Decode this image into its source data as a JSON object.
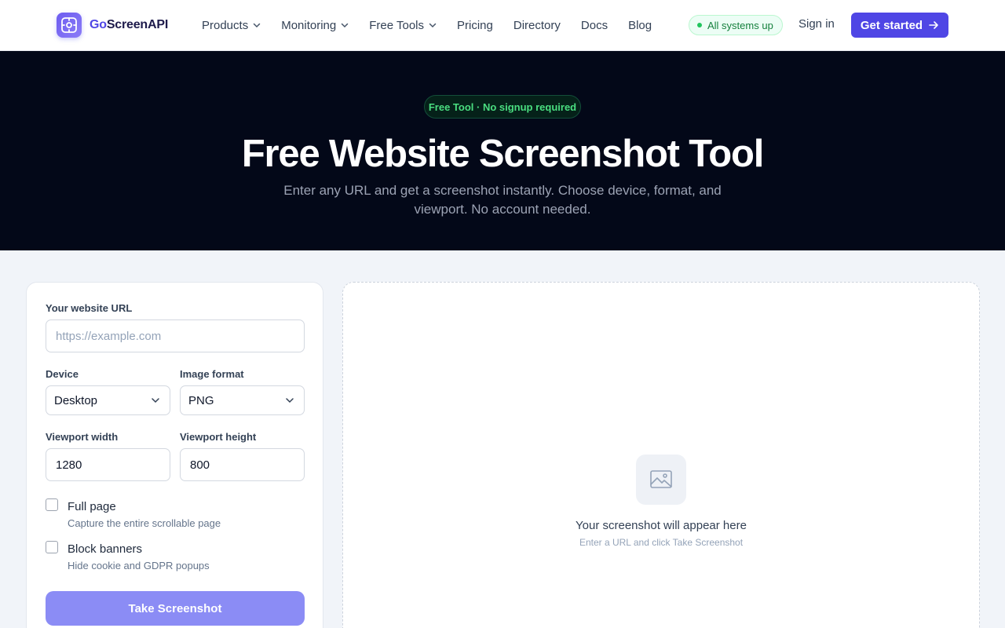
{
  "brand": {
    "prefix": "Go",
    "name": "ScreenAPI"
  },
  "nav": {
    "items": [
      {
        "label": "Products",
        "dropdown": true
      },
      {
        "label": "Monitoring",
        "dropdown": true
      },
      {
        "label": "Free Tools",
        "dropdown": true
      },
      {
        "label": "Pricing",
        "dropdown": false
      },
      {
        "label": "Directory",
        "dropdown": false
      },
      {
        "label": "Docs",
        "dropdown": false
      },
      {
        "label": "Blog",
        "dropdown": false
      }
    ],
    "status": "All systems up",
    "signin": "Sign in",
    "cta": "Get started"
  },
  "hero": {
    "pill": "Free Tool · No signup required",
    "title": "Free Website Screenshot Tool",
    "subtitle": "Enter any URL and get a screenshot instantly. Choose device, format, and viewport. No account needed."
  },
  "form": {
    "url_label": "Your website URL",
    "url_placeholder": "https://example.com",
    "device_label": "Device",
    "device_value": "Desktop",
    "format_label": "Image format",
    "format_value": "PNG",
    "width_label": "Viewport width",
    "width_value": "1280",
    "height_label": "Viewport height",
    "height_value": "800",
    "fullpage_title": "Full page",
    "fullpage_desc": "Capture the entire scrollable page",
    "banners_title": "Block banners",
    "banners_desc": "Hide cookie and GDPR popups",
    "submit": "Take Screenshot"
  },
  "preview": {
    "title": "Your screenshot will appear here",
    "subtitle": "Enter a URL and click Take Screenshot"
  },
  "colors": {
    "accent": "#4f46e5",
    "hero_bg": "#030818",
    "status_green": "#22c55e",
    "button_disabled": "#8b8cf5"
  }
}
